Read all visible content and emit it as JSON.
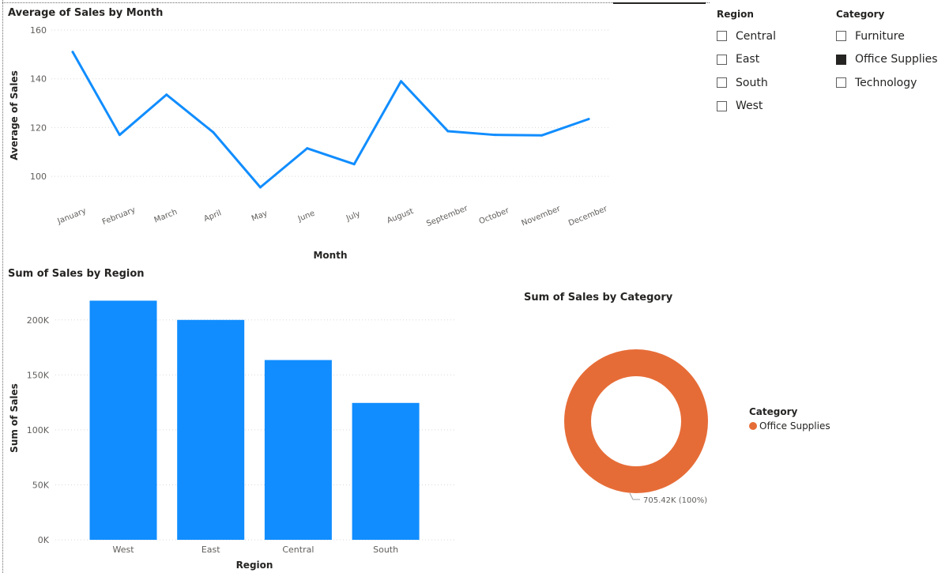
{
  "slicers": {
    "region": {
      "header": "Region",
      "items": [
        {
          "label": "Central",
          "checked": false
        },
        {
          "label": "East",
          "checked": false
        },
        {
          "label": "South",
          "checked": false
        },
        {
          "label": "West",
          "checked": false
        }
      ]
    },
    "category": {
      "header": "Category",
      "items": [
        {
          "label": "Furniture",
          "checked": false
        },
        {
          "label": "Office Supplies",
          "checked": true
        },
        {
          "label": "Technology",
          "checked": false
        }
      ]
    }
  },
  "colors": {
    "line": "#118dff",
    "bar": "#118dff",
    "donut": "#e66c37",
    "gridline": "#d9d9d9",
    "axis_text": "#605e5c"
  },
  "donut_legend": {
    "title": "Category",
    "item": "Office Supplies"
  },
  "chart_data": [
    {
      "type": "line",
      "title": "Average of Sales by Month",
      "xlabel": "Month",
      "ylabel": "Average of Sales",
      "categories": [
        "January",
        "February",
        "March",
        "April",
        "May",
        "June",
        "July",
        "August",
        "September",
        "October",
        "November",
        "December"
      ],
      "values": [
        151,
        117,
        133.5,
        118,
        95.5,
        111.5,
        105,
        139,
        118.5,
        117,
        116.8,
        123.5
      ],
      "ylim": [
        90,
        160
      ],
      "yticks": [
        100,
        120,
        140,
        160
      ],
      "ytick_labels": [
        "100",
        "120",
        "140",
        "160"
      ],
      "grid": true
    },
    {
      "type": "bar",
      "title": "Sum of Sales by Region",
      "xlabel": "Region",
      "ylabel": "Sum of Sales",
      "categories": [
        "West",
        "East",
        "Central",
        "South"
      ],
      "values": [
        217500,
        200000,
        163500,
        124500
      ],
      "ylim": [
        0,
        225000
      ],
      "yticks": [
        0,
        50000,
        100000,
        150000,
        200000
      ],
      "ytick_labels": [
        "0K",
        "50K",
        "100K",
        "150K",
        "200K"
      ],
      "grid": true
    },
    {
      "type": "pie",
      "title": "Sum of Sales by Category",
      "categories": [
        "Office Supplies"
      ],
      "values": [
        705420
      ],
      "data_labels": [
        "705.42K (100%)"
      ],
      "legend_title": "Category",
      "legend_position": "right"
    }
  ]
}
